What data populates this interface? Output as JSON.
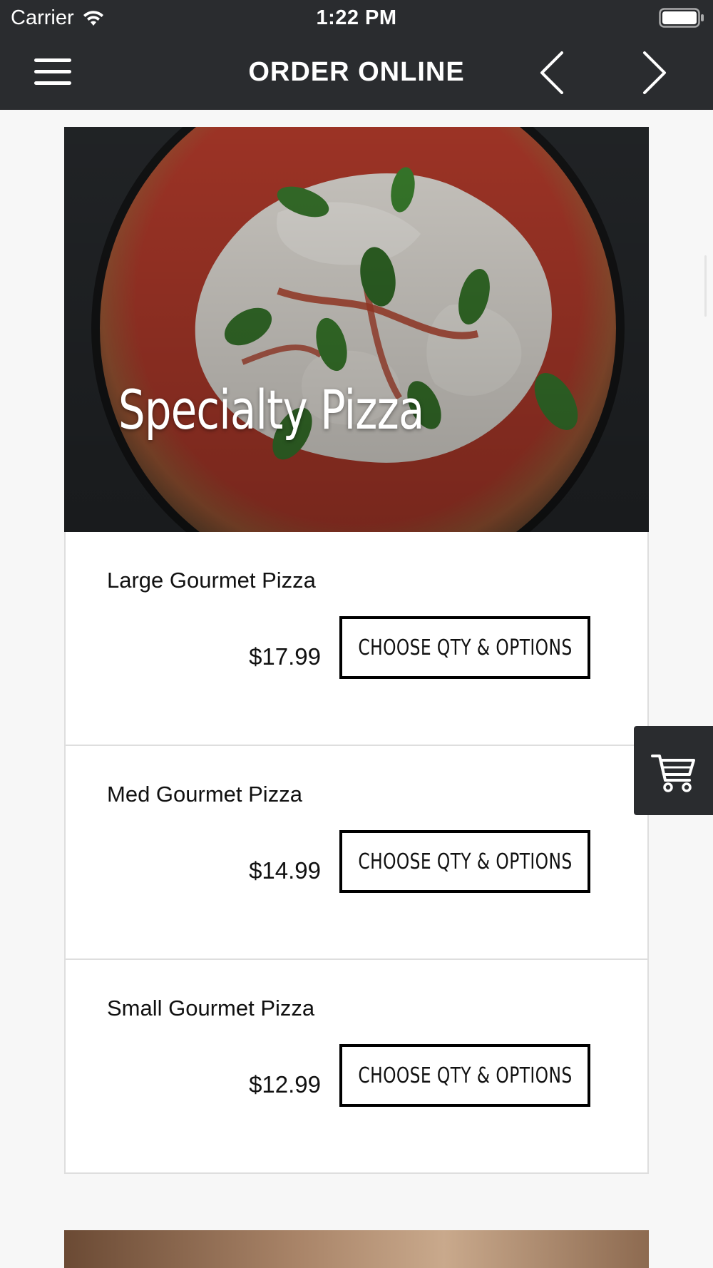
{
  "status_bar": {
    "carrier": "Carrier",
    "time": "1:22 PM"
  },
  "nav": {
    "title": "ORDER ONLINE"
  },
  "category": {
    "title": "Specialty Pizza"
  },
  "items": [
    {
      "name": "Large Gourmet Pizza",
      "price": "$17.99",
      "button_label": "CHOOSE QTY & OPTIONS"
    },
    {
      "name": "Med Gourmet Pizza",
      "price": "$14.99",
      "button_label": "CHOOSE QTY & OPTIONS"
    },
    {
      "name": "Small Gourmet Pizza",
      "price": "$12.99",
      "button_label": "CHOOSE QTY & OPTIONS"
    }
  ],
  "icons": {
    "menu": "menu-icon",
    "back": "chevron-left-icon",
    "forward": "chevron-right-icon",
    "cart": "cart-icon",
    "wifi": "wifi-icon",
    "battery": "battery-icon"
  },
  "colors": {
    "header_background": "#2a2c2f",
    "button_border": "#000000",
    "page_background": "#f7f7f7"
  }
}
